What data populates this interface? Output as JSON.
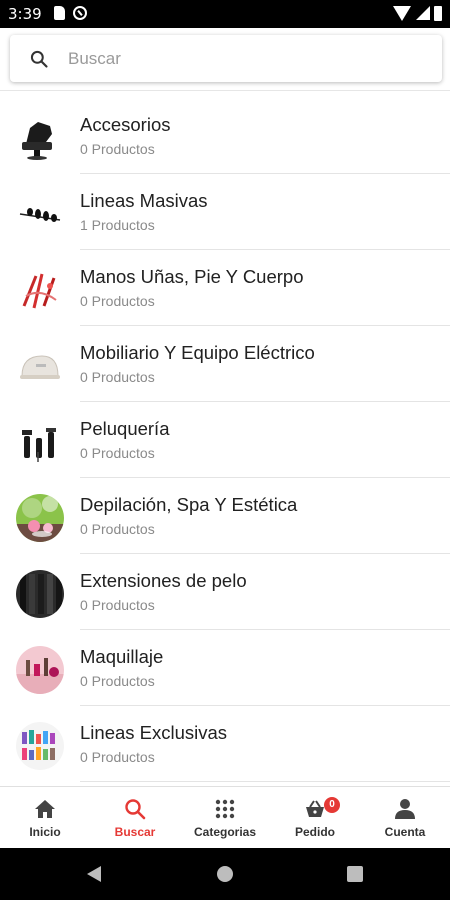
{
  "status_bar": {
    "time": "3:39"
  },
  "search": {
    "placeholder": "Buscar",
    "value": ""
  },
  "categories": [
    {
      "name": "Accesorios",
      "count": "0 Productos",
      "icon": "salon-chair-icon"
    },
    {
      "name": "Lineas Masivas",
      "count": "1 Productos",
      "icon": "brushes-icon"
    },
    {
      "name": "Manos Uñas, Pie Y Cuerpo",
      "count": "0 Productos",
      "icon": "nails-icon"
    },
    {
      "name": "Mobiliario Y Equipo Eléctrico",
      "count": "0 Productos",
      "icon": "nail-lamp-icon"
    },
    {
      "name": "Peluquería",
      "count": "0 Productos",
      "icon": "hair-products-icon"
    },
    {
      "name": "Depilación, Spa Y Estética",
      "count": "0 Productos",
      "icon": "spa-icon"
    },
    {
      "name": "Extensiones de pelo",
      "count": "0 Productos",
      "icon": "hair-extensions-icon"
    },
    {
      "name": "Maquillaje",
      "count": "0 Productos",
      "icon": "makeup-icon"
    },
    {
      "name": "Lineas Exclusivas",
      "count": "0 Productos",
      "icon": "exclusive-lines-icon"
    }
  ],
  "bottom_nav": {
    "items": [
      {
        "label": "Inicio",
        "icon": "home-icon"
      },
      {
        "label": "Buscar",
        "icon": "search-icon",
        "active": true
      },
      {
        "label": "Categorias",
        "icon": "grid-icon"
      },
      {
        "label": "Pedido",
        "icon": "basket-icon",
        "badge": "0"
      },
      {
        "label": "Cuenta",
        "icon": "person-icon"
      }
    ]
  },
  "colors": {
    "accent": "#e53935",
    "text": "#212121",
    "subtext": "#8a8a8a"
  }
}
